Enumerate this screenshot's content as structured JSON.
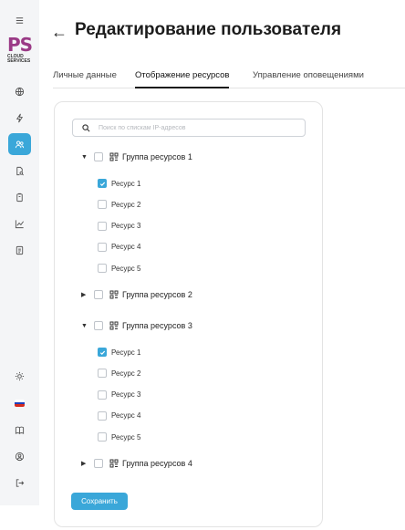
{
  "sidebar": {
    "logo": {
      "brand": "PS",
      "sub": "CLOUD SERVICES"
    },
    "items": [
      {
        "icon": "menu-icon"
      },
      {
        "icon": "globe-icon"
      },
      {
        "icon": "lightning-icon"
      },
      {
        "icon": "users-icon",
        "active": true
      },
      {
        "icon": "document-search-icon"
      },
      {
        "icon": "clipboard-icon"
      },
      {
        "icon": "chart-icon"
      },
      {
        "icon": "report-icon"
      },
      {
        "icon": "sun-icon"
      },
      {
        "icon": "flag-ru-icon"
      },
      {
        "icon": "book-icon"
      },
      {
        "icon": "user-circle-icon"
      },
      {
        "icon": "logout-icon"
      }
    ],
    "accent_color": "#3aa7d9"
  },
  "header": {
    "back": "←",
    "title": "Редактирование пользователя"
  },
  "tabs": [
    {
      "label": "Личные данные",
      "active": false
    },
    {
      "label": "Отображение ресурсов",
      "active": true
    },
    {
      "label": "Управление оповещениями",
      "active": false
    }
  ],
  "search": {
    "placeholder": "Поиск по спискам IP-адресов",
    "value": ""
  },
  "groups": [
    {
      "label": "Группа ресурсов 1",
      "expanded": true,
      "checked": false,
      "resources": [
        {
          "label": "Ресурс 1",
          "checked": true
        },
        {
          "label": "Ресурс 2",
          "checked": false
        },
        {
          "label": "Ресурс 3",
          "checked": false
        },
        {
          "label": "Ресурс 4",
          "checked": false
        },
        {
          "label": "Ресурс 5",
          "checked": false
        }
      ]
    },
    {
      "label": "Группа ресурсов 2",
      "expanded": false,
      "checked": false,
      "resources": []
    },
    {
      "label": "Группа ресурсов 3",
      "expanded": true,
      "checked": false,
      "resources": [
        {
          "label": "Ресурс 1",
          "checked": true
        },
        {
          "label": "Ресурс 2",
          "checked": false
        },
        {
          "label": "Ресурс 3",
          "checked": false
        },
        {
          "label": "Ресурс 4",
          "checked": false
        },
        {
          "label": "Ресурс 5",
          "checked": false
        }
      ]
    },
    {
      "label": "Группа ресурсов 4",
      "expanded": false,
      "checked": false,
      "resources": []
    }
  ],
  "save_label": "Сохранить"
}
